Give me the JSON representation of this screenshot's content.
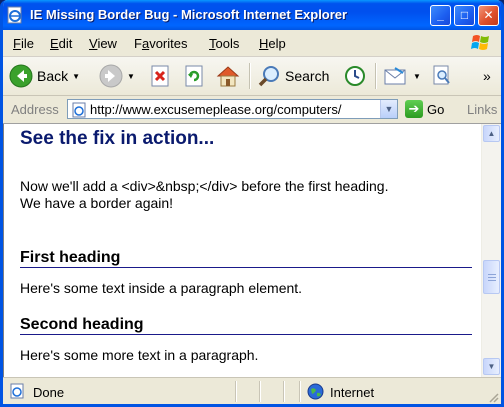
{
  "window": {
    "title": "IE Missing Border Bug - Microsoft Internet Explorer",
    "controls": {
      "minimize": "_",
      "maximize": "□",
      "close": "✕"
    }
  },
  "menubar": {
    "items": [
      {
        "label": "File",
        "accel": "F",
        "rest": "ile"
      },
      {
        "label": "Edit",
        "accel": "E",
        "rest": "dit"
      },
      {
        "label": "View",
        "accel": "V",
        "rest": "iew"
      },
      {
        "label": "Favorites",
        "pre": "F",
        "accel": "a",
        "rest": "vorites"
      },
      {
        "label": "Tools",
        "accel": "T",
        "rest": "ools"
      },
      {
        "label": "Help",
        "accel": "H",
        "rest": "elp"
      }
    ]
  },
  "toolbar": {
    "back_label": "Back",
    "search_label": "Search",
    "overflow": "»",
    "icons": [
      "back-icon",
      "forward-icon",
      "stop-icon",
      "refresh-icon",
      "home-icon",
      "search-icon",
      "history-icon",
      "mail-icon",
      "print-preview-icon"
    ]
  },
  "addressbar": {
    "label": "Address",
    "url": "http://www.excusemeplease.org/computers/",
    "go_label": "Go",
    "links_label": "Links"
  },
  "page": {
    "heading_fix": "See the fix in action...",
    "intro_line1": "Now we'll add a <div>&nbsp;</div> before the first heading.",
    "intro_line2": "We have a border again!",
    "heading1": "First heading",
    "para1": "Here's some text inside a paragraph element.",
    "heading2": "Second heading",
    "para2": "Here's some more text in a paragraph."
  },
  "statusbar": {
    "status": "Done",
    "zone": "Internet"
  },
  "colors": {
    "titlebar": "#0054e3",
    "heading_fix": "#0a1a6e",
    "heading_rule": "#1a1a8a"
  }
}
